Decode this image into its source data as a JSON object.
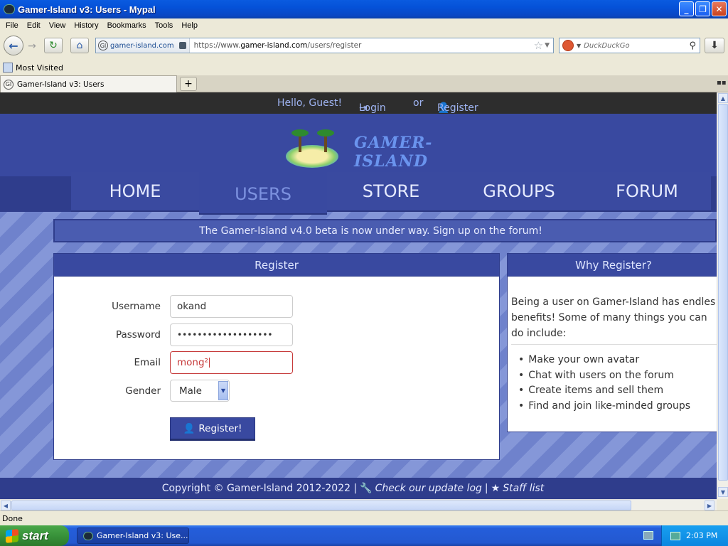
{
  "window": {
    "title": "Gamer-Island v3: Users - Mypal",
    "minimize": "_",
    "maximize": "❐",
    "close": "✕"
  },
  "menu": [
    "File",
    "Edit",
    "View",
    "History",
    "Bookmarks",
    "Tools",
    "Help"
  ],
  "nav": {
    "identity": "gamer-island.com",
    "url_prefix": "https://www.",
    "url_host": "gamer-island.com",
    "url_path": "/users/register",
    "search_placeholder": "DuckDuckGo"
  },
  "bookmarks": {
    "most_visited": "Most Visited"
  },
  "tab": {
    "label": "Gamer-Island v3: Users"
  },
  "site": {
    "greeting": "Hello, Guest!",
    "login": "Login",
    "or": "or",
    "register": "Register",
    "logo_text": "GAMER-ISLAND",
    "nav": [
      "HOME",
      "USERS",
      "STORE",
      "GROUPS",
      "FORUM"
    ],
    "active_nav": "USERS",
    "announcement": "The Gamer-Island v4.0 beta is now under way. Sign up on the forum!"
  },
  "register_form": {
    "heading": "Register",
    "username_label": "Username",
    "username_value": "okand",
    "password_label": "Password",
    "password_value": "•••••••••••••••••••",
    "email_label": "Email",
    "email_value": "mong²",
    "gender_label": "Gender",
    "gender_value": "Male",
    "submit_label": "Register!"
  },
  "why": {
    "heading": "Why Register?",
    "intro_lines": [
      "Being a user on Gamer-Island has endles",
      "benefits! Some of many things you can",
      "do include:"
    ],
    "items": [
      "Make your own avatar",
      "Chat with users on the forum",
      "Create items and sell them",
      "Find and join like-minded groups"
    ]
  },
  "footer": {
    "copyright": "Copyright © Gamer-Island 2012-2022 |",
    "update_log": "Check our update log",
    "sep": "|",
    "staff": "Staff list"
  },
  "status": {
    "text": "Done"
  },
  "taskbar": {
    "start": "start",
    "task": "Gamer-Island v3: Use...",
    "clock": "2:03 PM"
  }
}
